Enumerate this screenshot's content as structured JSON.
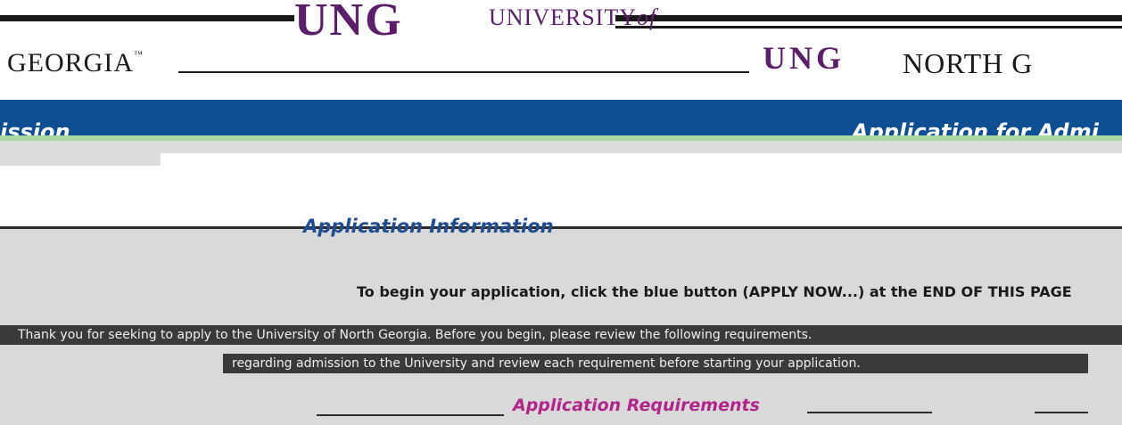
{
  "header": {
    "logo_ung": "UNG",
    "logo_university_of": "UNIVERSITY",
    "logo_of": "of",
    "word_georgia": "GEORGIA",
    "trademark": "™",
    "logo_ung_small": "UNG",
    "word_north": "NORTH G"
  },
  "titlebar": {
    "left_text": "ission",
    "right_text": "Application for Admi"
  },
  "main": {
    "info_heading": "Application Information",
    "instruction": "To begin your application, click the blue button (APPLY NOW...) at the END OF THIS PAGE",
    "paragraph_line1": "Thank you for seeking to apply to the University of North Georgia. Before you begin, please review the following requirements.",
    "paragraph_line2": "regarding admission to the University and review each requirement before starting your application.",
    "requirements_heading": "Application Requirements"
  },
  "colors": {
    "navy": "#0e4f94",
    "purple": "#5b1f69",
    "magenta": "#b0268a",
    "heading_blue": "#1f4d8f",
    "panel_grey": "#d9d9d9"
  }
}
